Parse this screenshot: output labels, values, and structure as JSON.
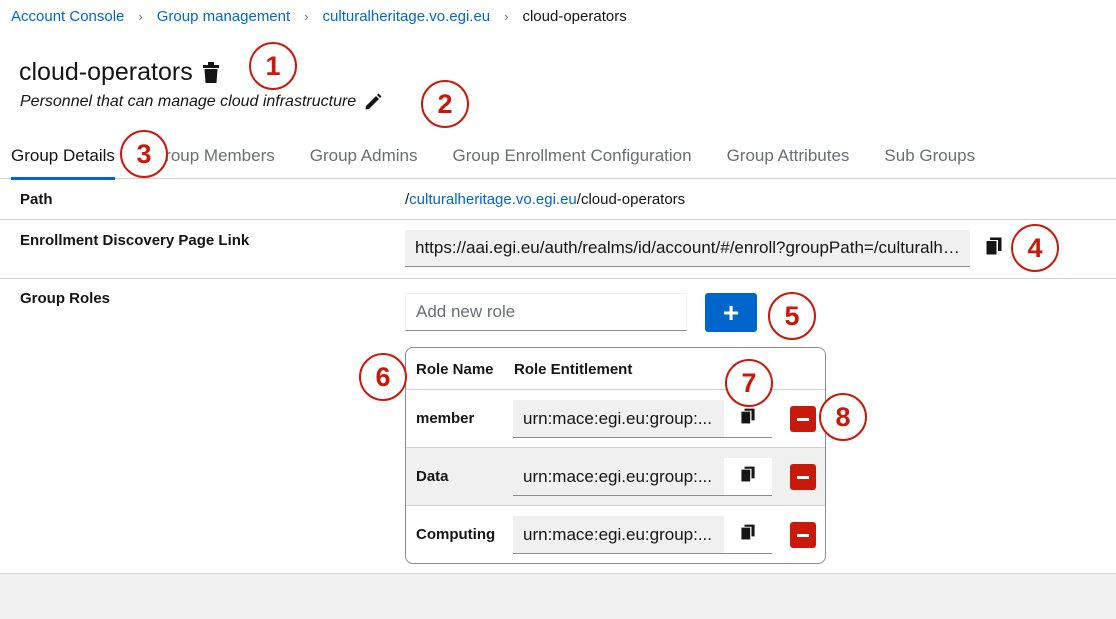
{
  "breadcrumb": {
    "items": [
      "Account Console",
      "Group management",
      "culturalheritage.vo.egi.eu"
    ],
    "current": "cloud-operators",
    "separator": "›"
  },
  "header": {
    "title": "cloud-operators",
    "description": "Personnel that can manage cloud infrastructure"
  },
  "tabs": [
    {
      "label": "Group Details",
      "active": true
    },
    {
      "label": "Group Members"
    },
    {
      "label": "Group Admins"
    },
    {
      "label": "Group Enrollment Configuration"
    },
    {
      "label": "Group Attributes"
    },
    {
      "label": "Sub Groups"
    }
  ],
  "details": {
    "path_label": "Path",
    "path_prefix": "/",
    "path_link": "culturalheritage.vo.egi.eu",
    "path_suffix": "/cloud-operators",
    "enrollment_label": "Enrollment Discovery Page Link",
    "enrollment_value": "https://aai.egi.eu/auth/realms/id/account/#/enroll?groupPath=/culturalheritage.vo.egi.eu/cloud-operators",
    "roles_label": "Group Roles",
    "add_role_placeholder": "Add new role",
    "add_role_button": "+"
  },
  "roles_table": {
    "headers": [
      "Role Name",
      "Role Entitlement"
    ],
    "rows": [
      {
        "name": "member",
        "entitlement": "urn:mace:egi.eu:group:..."
      },
      {
        "name": "Data",
        "entitlement": "urn:mace:egi.eu:group:..."
      },
      {
        "name": "Computing",
        "entitlement": "urn:mace:egi.eu:group:..."
      }
    ]
  },
  "callouts": [
    "1",
    "2",
    "3",
    "4",
    "5",
    "6",
    "7",
    "8"
  ],
  "colors": {
    "link": "#0066cc",
    "accent": "#0066cc",
    "danger": "#c9190b",
    "callout": "#c9190b"
  },
  "icons": {
    "delete": "trash-icon",
    "edit": "pencil-icon",
    "copy": "copy-icon",
    "remove": "minus-icon"
  }
}
